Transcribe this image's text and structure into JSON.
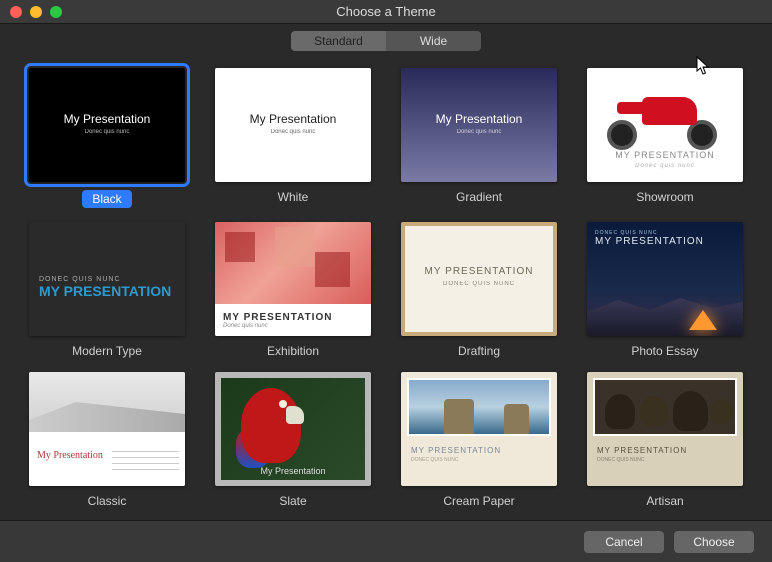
{
  "window": {
    "title": "Choose a Theme"
  },
  "segmented": {
    "standard": "Standard",
    "wide": "Wide",
    "active": "Standard"
  },
  "preview": {
    "title": "My Presentation",
    "subtitle": "Donec quis nunc",
    "titleUpper": "MY PRESENTATION",
    "subtitleUpper": "DONEC QUIS NUNC",
    "subtitleItalic": "Donec quis nunc"
  },
  "themes": [
    {
      "id": "black",
      "label": "Black",
      "selected": true
    },
    {
      "id": "white",
      "label": "White"
    },
    {
      "id": "gradient",
      "label": "Gradient"
    },
    {
      "id": "showroom",
      "label": "Showroom"
    },
    {
      "id": "modern",
      "label": "Modern Type"
    },
    {
      "id": "exhibition",
      "label": "Exhibition"
    },
    {
      "id": "drafting",
      "label": "Drafting"
    },
    {
      "id": "photoessay",
      "label": "Photo Essay"
    },
    {
      "id": "classic",
      "label": "Classic"
    },
    {
      "id": "slate",
      "label": "Slate"
    },
    {
      "id": "creampaper",
      "label": "Cream Paper"
    },
    {
      "id": "artisan",
      "label": "Artisan"
    }
  ],
  "footer": {
    "cancel": "Cancel",
    "choose": "Choose"
  }
}
